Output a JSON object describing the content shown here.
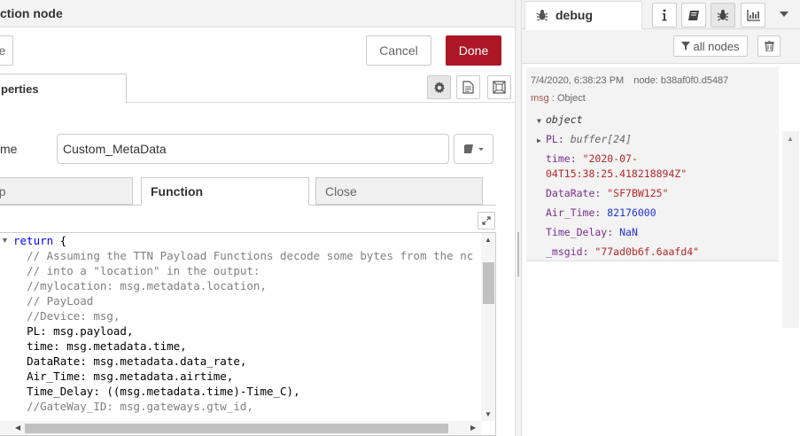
{
  "editor": {
    "title": "ction node",
    "left_button_label": "e",
    "cancel_label": "Cancel",
    "done_label": "Done",
    "tab_properties_label": "perties",
    "name_label": "me",
    "name_value": "Custom_MetaData",
    "subtabs": [
      "up",
      "Function",
      "Close"
    ],
    "code_lines": [
      {
        "indent": "",
        "kw": "return",
        "rest": " {",
        "type": "code"
      },
      {
        "indent": "  ",
        "text": "// Assuming the TTN Payload Functions decode some bytes from the nc",
        "type": "comment"
      },
      {
        "indent": "  ",
        "text": "// into a \"location\" in the output:",
        "type": "comment"
      },
      {
        "indent": "  ",
        "text": "//mylocation: msg.metadata.location,",
        "type": "comment"
      },
      {
        "indent": "  ",
        "text": "// PayLoad",
        "type": "comment"
      },
      {
        "indent": "  ",
        "text": "//Device: msg,",
        "type": "comment"
      },
      {
        "indent": "  ",
        "text": "PL: msg.payload,",
        "type": "plain"
      },
      {
        "indent": "  ",
        "text": "time: msg.metadata.time,",
        "type": "plain"
      },
      {
        "indent": "  ",
        "text": "DataRate: msg.metadata.data_rate,",
        "type": "plain"
      },
      {
        "indent": "  ",
        "text": "Air_Time: msg.metadata.airtime,",
        "type": "plain"
      },
      {
        "indent": "  ",
        "text": "Time_Delay: ((msg.metadata.time)-Time_C),",
        "type": "plain"
      },
      {
        "indent": "  ",
        "text": "//GateWay_ID: msg.gateways.gtw_id,",
        "type": "comment"
      }
    ]
  },
  "sidebar": {
    "tab_label": "debug",
    "filter_label": "all nodes",
    "message": {
      "timestamp": "7/4/2020, 6:38:23 PM",
      "node": "node: b38af0f0.d5487",
      "topic_key": "msg",
      "topic_sep": " : ",
      "topic_type": "Object",
      "root_label": "object",
      "props": [
        {
          "key": "PL",
          "sep": ": ",
          "value": "buffer[24]",
          "kind": "meta",
          "expandable": true
        },
        {
          "key": "time",
          "sep": ": ",
          "value": "\"2020-07-",
          "kind": "str",
          "expandable": false
        },
        {
          "key": "",
          "sep": "",
          "value": "04T15:38:25.418218894Z\"",
          "kind": "str",
          "expandable": false
        },
        {
          "key": "DataRate",
          "sep": ": ",
          "value": "\"SF7BW125\"",
          "kind": "str",
          "expandable": false
        },
        {
          "key": "Air_Time",
          "sep": ": ",
          "value": "82176000",
          "kind": "num",
          "expandable": false
        },
        {
          "key": "Time_Delay",
          "sep": ": ",
          "value": "NaN",
          "kind": "num",
          "expandable": false
        },
        {
          "key": "_msgid",
          "sep": ": ",
          "value": "\"77ad0b6f.6aafd4\"",
          "kind": "str",
          "expandable": false
        }
      ]
    }
  },
  "colors": {
    "done_button": "#ad1625",
    "keyword": "#0000ff",
    "comment": "#808080",
    "prop_key": "#792e90",
    "string_value": "#b72828",
    "number_value": "#2033d6"
  }
}
